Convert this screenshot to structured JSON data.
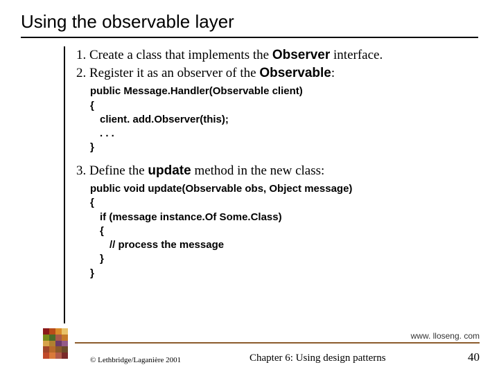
{
  "title": "Using the observable layer",
  "items": {
    "one": {
      "num": "1.",
      "before": " Create a class that implements the ",
      "kw": "Observer",
      "after": " interface."
    },
    "two": {
      "num": "2.",
      "before": " Register it as an observer of the ",
      "kw": "Observable",
      "after": ":"
    },
    "three": {
      "num": "3.",
      "before": " Define the ",
      "kw": "update",
      "after": " method in the new class:"
    }
  },
  "code1": {
    "l1": "public Message.Handler(Observable client)",
    "l2": "{",
    "l3": "client. add.Observer(this);",
    "l4": ". . .",
    "l5": "}"
  },
  "code2": {
    "l1": "public void update(Observable obs, Object message)",
    "l2": "{",
    "l3": "if (message instance.Of Some.Class)",
    "l4": "{",
    "l5": "// process the message",
    "l6": "}",
    "l7": "}"
  },
  "url": "www. lloseng. com",
  "footer": {
    "copyright": "© Lethbridge/Laganière 2001",
    "chapter": "Chapter 6: Using design patterns",
    "page": "40"
  }
}
